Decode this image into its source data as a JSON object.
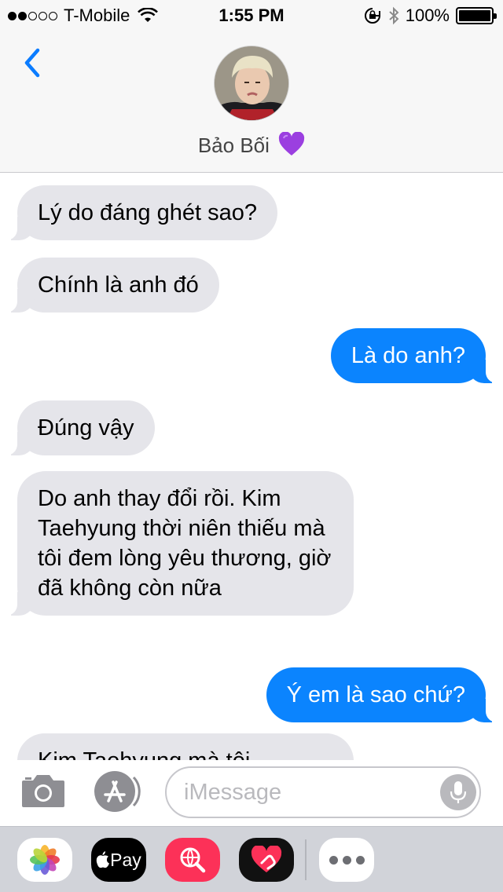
{
  "status_bar": {
    "signal_bars_filled": 2,
    "signal_bars_total": 5,
    "carrier": "T-Mobile",
    "time": "1:55 PM",
    "battery": "100%"
  },
  "header": {
    "contact_name": "Bảo Bối",
    "back_icon": "chevron-left-icon",
    "name_emoji_icon": "purple-heart-icon"
  },
  "messages": [
    {
      "direction": "in",
      "text": "Lý do đáng ghét sao?"
    },
    {
      "direction": "in",
      "text": "Chính là anh đó"
    },
    {
      "direction": "out",
      "text": "Là do anh?"
    },
    {
      "direction": "in",
      "text": "Đúng vậy"
    },
    {
      "direction": "in",
      "text": "Do anh thay đổi rồi. Kim Taehyung thời niên thiếu mà tôi đem lòng yêu thương, giờ đã không còn nữa"
    },
    {
      "direction": "out",
      "text": "Ý em là sao chứ?"
    },
    {
      "direction": "in",
      "text": "Kim Taehyung mà tôi"
    }
  ],
  "input_bar": {
    "placeholder": "iMessage",
    "camera_icon": "camera-icon",
    "app_store_icon": "app-store-icon",
    "mic_icon": "microphone-icon"
  },
  "app_drawer": {
    "apps": [
      "photos-icon",
      "apple-pay-icon",
      "image-search-icon",
      "digital-touch-icon",
      "more-icon"
    ],
    "apple_pay_label": "Pay"
  },
  "colors": {
    "outgoing_bubble": "#0b84fe",
    "incoming_bubble": "#e5e5ea",
    "accent": "#0b7cff"
  }
}
